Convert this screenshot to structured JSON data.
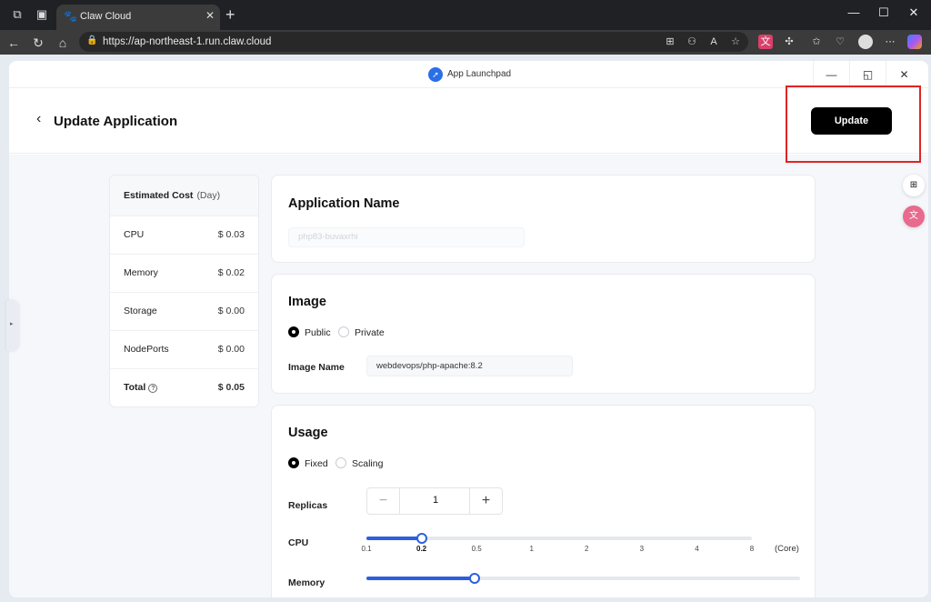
{
  "browser": {
    "tab_title": "Claw Cloud",
    "url": "https://ap-northeast-1.run.claw.cloud"
  },
  "window": {
    "title": "App Launchpad"
  },
  "header": {
    "title": "Update Application",
    "update_label": "Update"
  },
  "cost": {
    "title": "Estimated Cost",
    "period": "(Day)",
    "rows": [
      {
        "label": "CPU",
        "value": "$ 0.03"
      },
      {
        "label": "Memory",
        "value": "$ 0.02"
      },
      {
        "label": "Storage",
        "value": "$ 0.00"
      },
      {
        "label": "NodePorts",
        "value": "$ 0.00"
      }
    ],
    "total_label": "Total",
    "total_value": "$ 0.05"
  },
  "app_name": {
    "title": "Application Name",
    "value": "php83-buvaxrhi"
  },
  "image": {
    "title": "Image",
    "options": [
      "Public",
      "Private"
    ],
    "selected": "Public",
    "name_label": "Image Name",
    "name_value": "webdevops/php-apache:8.2"
  },
  "usage": {
    "title": "Usage",
    "options": [
      "Fixed",
      "Scaling"
    ],
    "selected": "Fixed",
    "replicas_label": "Replicas",
    "replicas_value": "1",
    "minus": "−",
    "plus": "+",
    "cpu_label": "CPU",
    "cpu_ticks": [
      "0.1",
      "0.2",
      "0.5",
      "1",
      "2",
      "3",
      "4",
      "8"
    ],
    "cpu_selected_index": 1,
    "cpu_unit": "(Core)",
    "memory_label": "Memory",
    "memory_selected_index": 2
  },
  "colors": {
    "accent": "#2b5fe0",
    "primary_button": "#000000",
    "highlight_box": "#e02424"
  }
}
